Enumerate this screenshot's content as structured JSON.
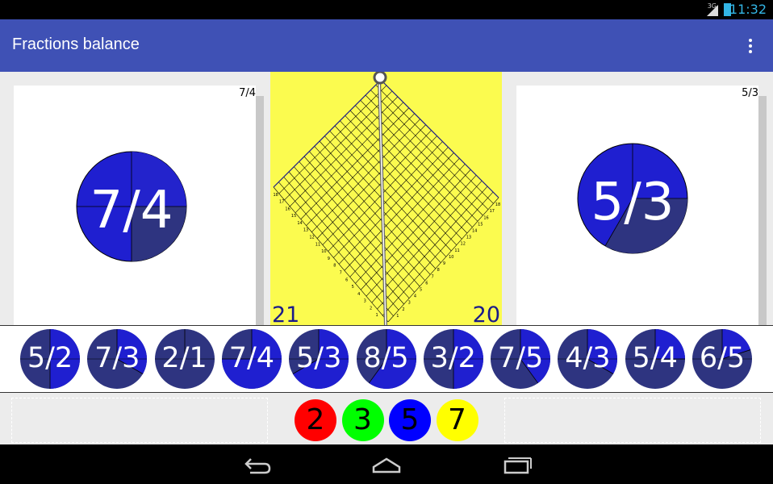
{
  "status_bar": {
    "network": "3G",
    "time": "11:32"
  },
  "app_bar": {
    "title": "Fractions balance",
    "menu_icon": "overflow-menu-icon"
  },
  "left_pan": {
    "label": "7/4",
    "circle_label": "7/4"
  },
  "right_pan": {
    "label": "5/3",
    "circle_label": "5/3"
  },
  "balance": {
    "left_count": "21",
    "right_count": "20"
  },
  "fraction_chips": [
    "5/2",
    "7/3",
    "2/1",
    "7/4",
    "5/3",
    "8/5",
    "3/2",
    "7/5",
    "4/3",
    "5/4",
    "6/5"
  ],
  "fraction_values": [
    2.5,
    2.3333,
    2.0,
    1.75,
    1.6667,
    1.6,
    1.5,
    1.4,
    1.3333,
    1.25,
    1.2
  ],
  "primes": [
    {
      "label": "2",
      "color": "#ff0000"
    },
    {
      "label": "3",
      "color": "#00ff00"
    },
    {
      "label": "5",
      "color": "#0000ff"
    },
    {
      "label": "7",
      "color": "#ffff00"
    }
  ],
  "colors": {
    "app_bar": "#3f51b5",
    "chip_dark": "#2e3480",
    "chip_bright": "#1f1fd0",
    "balance_bg": "#fbfb4f"
  },
  "nav": {
    "back_icon": "back-icon",
    "home_icon": "home-icon",
    "recents_icon": "recents-icon"
  }
}
